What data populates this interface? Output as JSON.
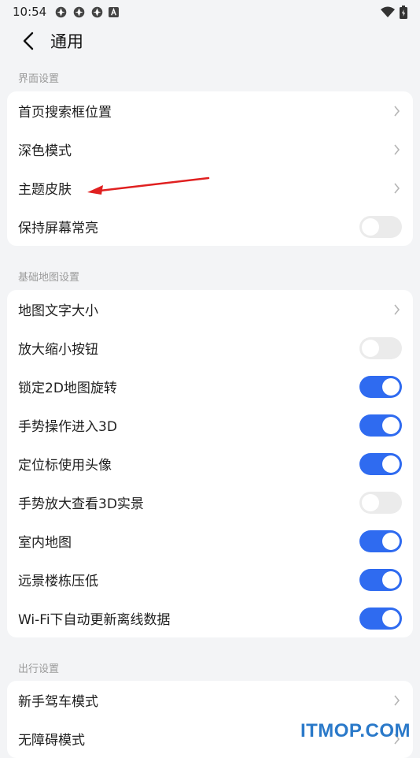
{
  "status_bar": {
    "time": "10:54",
    "icons": [
      "app-icon-1",
      "app-icon-2",
      "app-icon-3",
      "a-icon"
    ],
    "right_icons": [
      "wifi-icon",
      "battery-icon"
    ]
  },
  "header": {
    "title": "通用",
    "back_icon": "back-arrow-icon"
  },
  "sections": [
    {
      "label": "界面设置",
      "rows": [
        {
          "label": "首页搜索框位置",
          "type": "nav"
        },
        {
          "label": "深色模式",
          "type": "nav"
        },
        {
          "label": "主题皮肤",
          "type": "nav"
        },
        {
          "label": "保持屏幕常亮",
          "type": "toggle",
          "on": false
        }
      ]
    },
    {
      "label": "基础地图设置",
      "rows": [
        {
          "label": "地图文字大小",
          "type": "nav"
        },
        {
          "label": "放大缩小按钮",
          "type": "toggle",
          "on": false
        },
        {
          "label": "锁定2D地图旋转",
          "type": "toggle",
          "on": true
        },
        {
          "label": "手势操作进入3D",
          "type": "toggle",
          "on": true
        },
        {
          "label": "定位标使用头像",
          "type": "toggle",
          "on": true
        },
        {
          "label": "手势放大查看3D实景",
          "type": "toggle",
          "on": false
        },
        {
          "label": "室内地图",
          "type": "toggle",
          "on": true
        },
        {
          "label": "远景楼栋压低",
          "type": "toggle",
          "on": true
        },
        {
          "label": "Wi-Fi下自动更新离线数据",
          "type": "toggle",
          "on": true
        }
      ]
    },
    {
      "label": "出行设置",
      "rows": [
        {
          "label": "新手驾车模式",
          "type": "nav"
        },
        {
          "label": "无障碍模式",
          "type": "nav"
        }
      ]
    }
  ],
  "colors": {
    "accent": "#2f6bf0",
    "toggle_off": "#ebebeb",
    "background": "#f3f4f6",
    "annotation_arrow": "#e02020"
  },
  "watermark": "ITMOP.COM"
}
